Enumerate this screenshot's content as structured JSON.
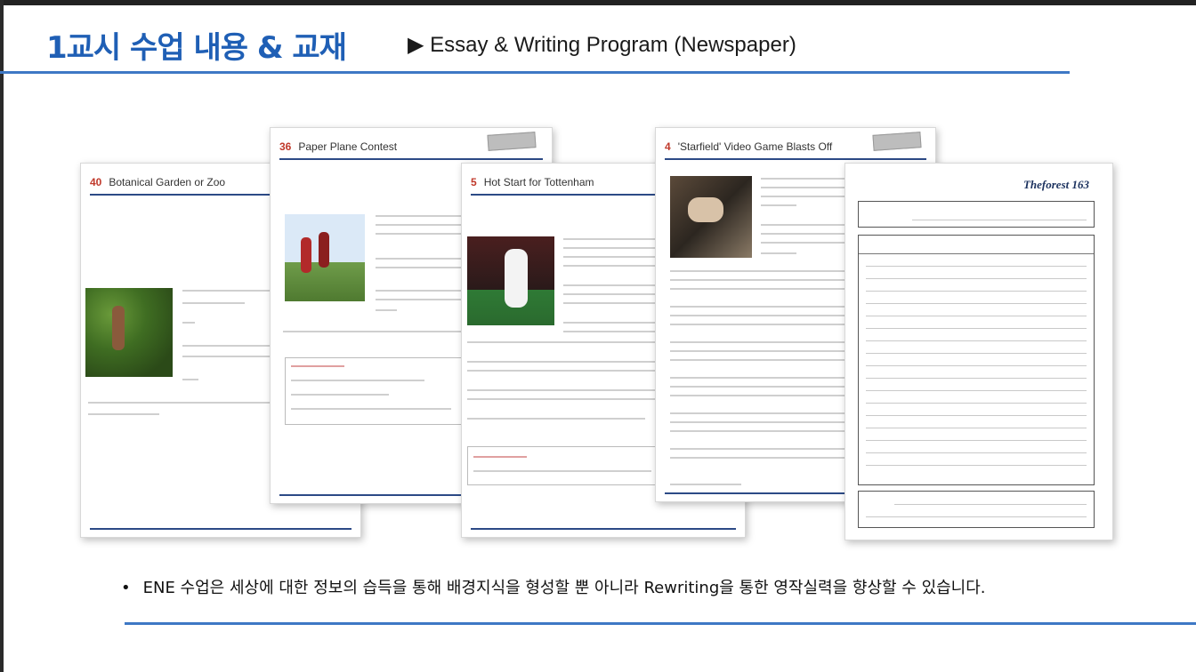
{
  "header": {
    "title_kr": "1교시 수업 내용 & 교재",
    "title_en": "▶ Essay & Writing Program (Newspaper)"
  },
  "pages": {
    "garden": {
      "num": "40",
      "title": "Botanical Garden or Zoo"
    },
    "plane": {
      "num": "36",
      "title": "Paper Plane Contest"
    },
    "tottenham": {
      "num": "5",
      "title": "Hot Start for Tottenham"
    },
    "starfield": {
      "num": "4",
      "title": "'Starfield' Video Game Blasts Off"
    },
    "forest": {
      "logo": "Theforest 163"
    }
  },
  "footer": {
    "bullet": "ENE 수업은 세상에 대한 정보의 습득을 통해 배경지식을 형성할 뿐 아니라 Rewriting을 통한 영작실력을 향상할 수 있습니다."
  },
  "colors": {
    "accent_blue": "#1f5fb5",
    "rule_blue": "#3e78c5",
    "page_rule": "#2c4a86",
    "number_red": "#c0392b"
  }
}
